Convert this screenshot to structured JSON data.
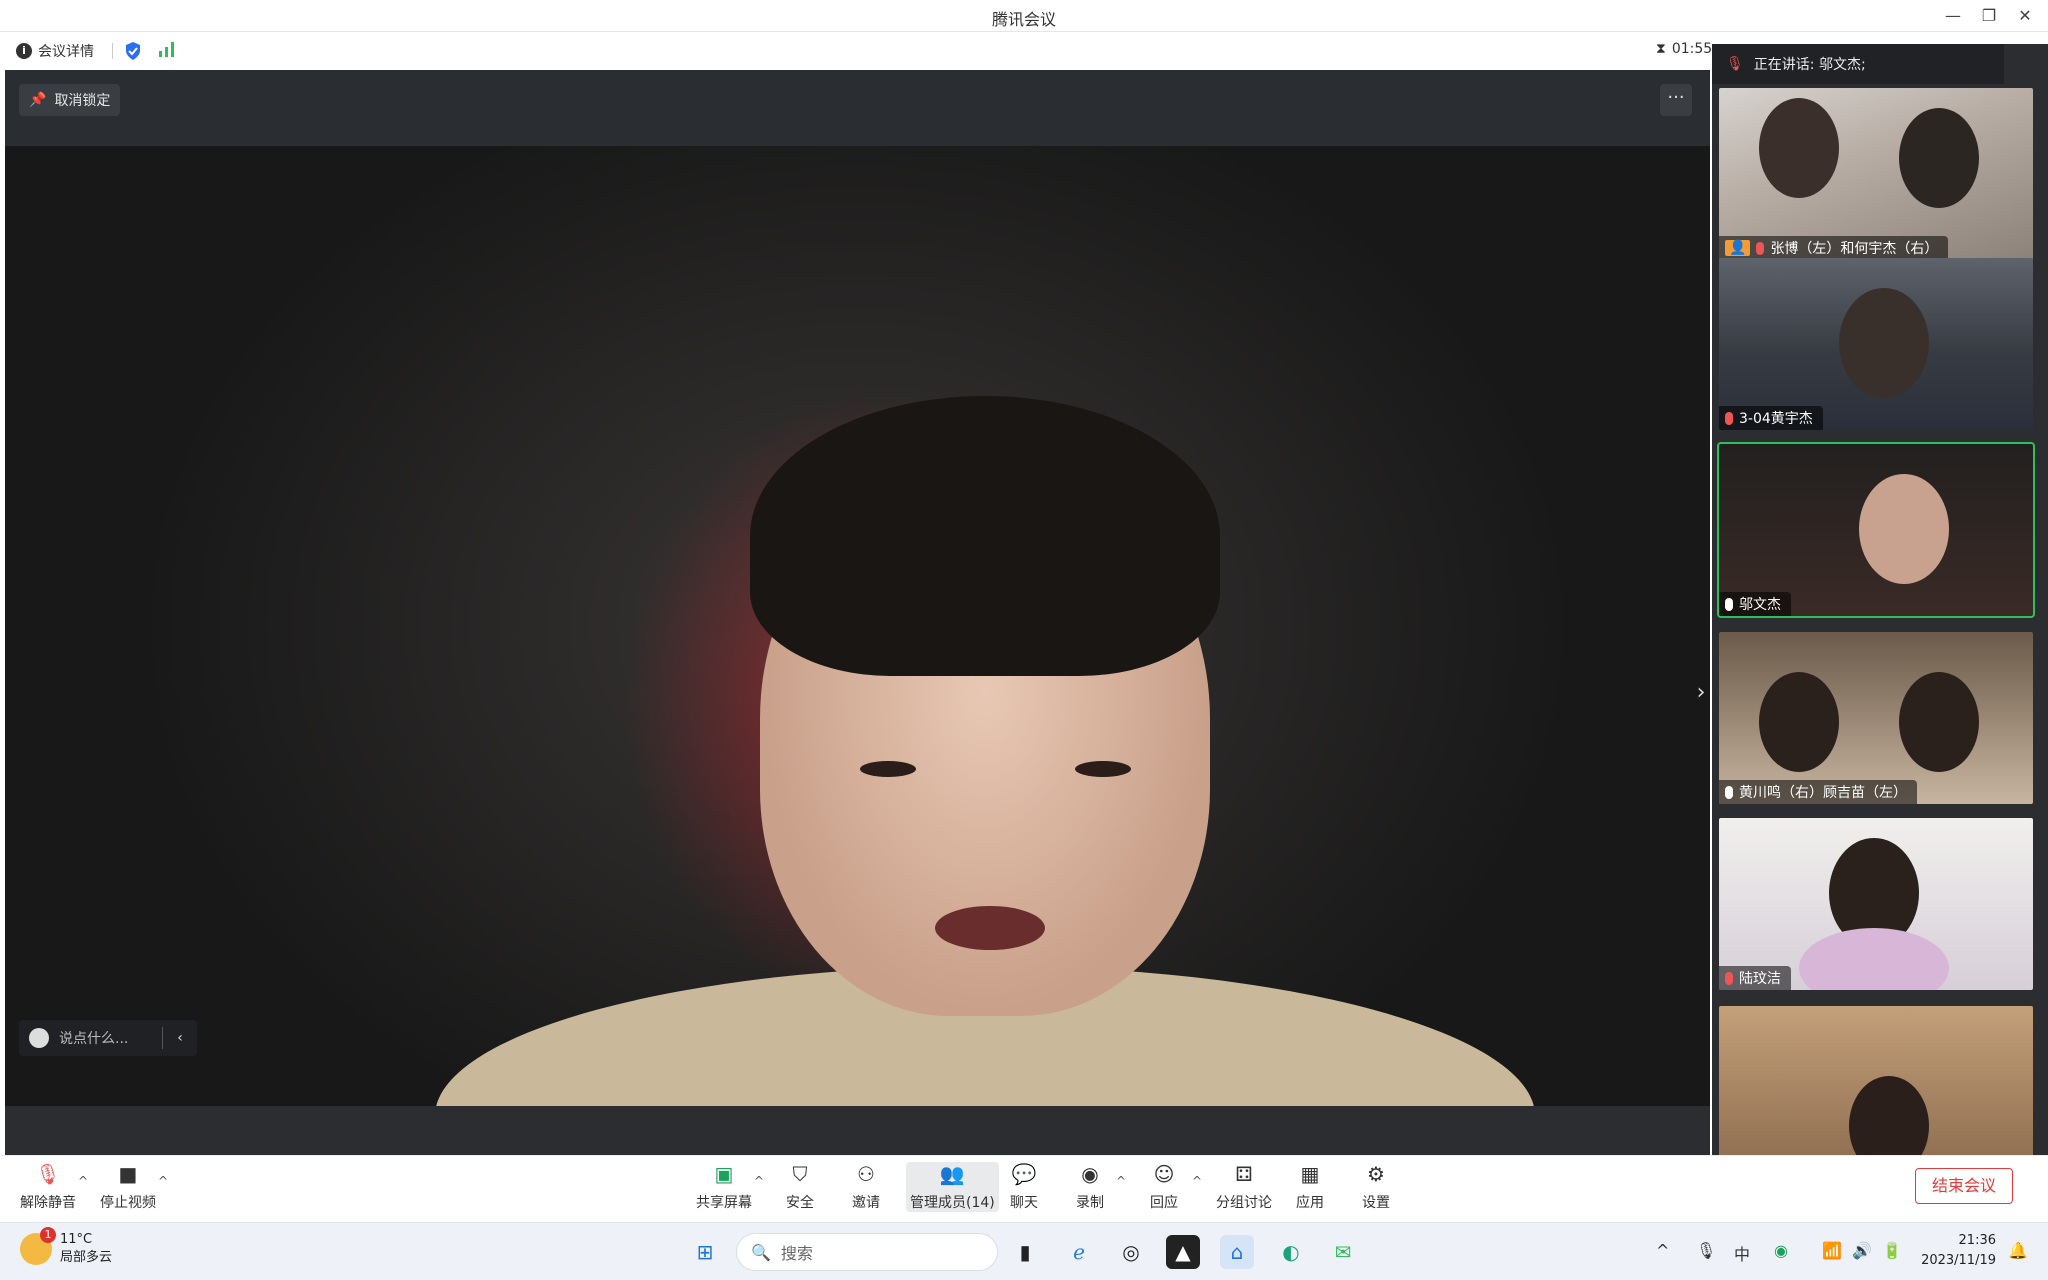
{
  "window": {
    "title": "腾讯会议"
  },
  "infobar": {
    "meeting_details": "会议详情",
    "timer": "01:55"
  },
  "stage": {
    "unpin_label": "取消锁定",
    "more_label": "···",
    "chat_placeholder": "说点什么..."
  },
  "panel": {
    "speaking_label": "正在讲话:  邬文杰;",
    "tiles": [
      {
        "name": "张博（左）和何宇杰（右）",
        "muted": true
      },
      {
        "name": "3-04黄宇杰",
        "muted": true
      },
      {
        "name": "邬文杰",
        "muted": false
      },
      {
        "name": "黄川鸣（右）顾吉苗（左）",
        "muted": false
      },
      {
        "name": "陆玟洁",
        "muted": true
      }
    ]
  },
  "toolbar": {
    "unmute": "解除静音",
    "stop_video": "停止视频",
    "share_screen": "共享屏幕",
    "security": "安全",
    "invite": "邀请",
    "manage_members": "管理成员(14)",
    "chat": "聊天",
    "record": "录制",
    "reaction": "回应",
    "breakout": "分组讨论",
    "apps": "应用",
    "settings": "设置",
    "end_meeting": "结束会议"
  },
  "taskbar": {
    "weather_temp": "11°C",
    "weather_desc": "局部多云",
    "weather_badge": "1",
    "search_label": "搜索",
    "ime": "中",
    "time": "21:36",
    "date": "2023/11/19"
  },
  "colors": {
    "accent_green": "#2fbf5a",
    "end_red": "#e8393a",
    "stage_bg": "#2b2d31"
  }
}
